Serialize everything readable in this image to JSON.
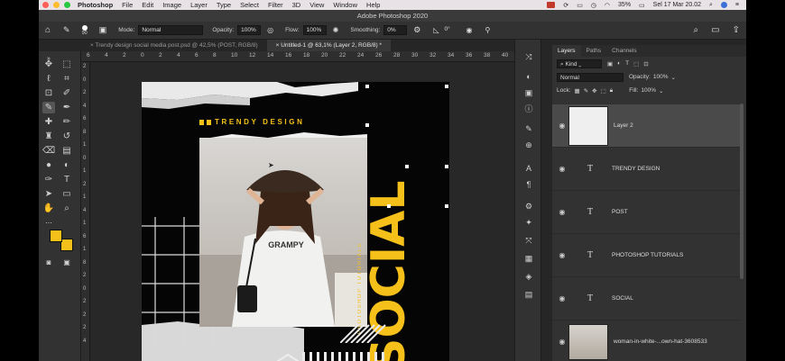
{
  "menubar": {
    "apple": "",
    "items": [
      "Photoshop",
      "File",
      "Edit",
      "Image",
      "Layer",
      "Type",
      "Select",
      "Filter",
      "3D",
      "View",
      "Window",
      "Help"
    ],
    "battery": "35%",
    "clock": "Sel 17 Mar  20.02"
  },
  "window": {
    "title": "Adobe Photoshop 2020"
  },
  "options": {
    "brush_size": "90",
    "mode_label": "Mode:",
    "mode_value": "Normal",
    "opacity_label": "Opacity:",
    "opacity_value": "100%",
    "flow_label": "Flow:",
    "flow_value": "100%",
    "smoothing_label": "Smoothing:",
    "smoothing_value": "0%",
    "angle_value": "0°"
  },
  "tabs": [
    {
      "label": "Trendy design social media post.psd @ 42,5% (POST, RGB/8)"
    },
    {
      "label": "Untitled-1 @ 63,1% (Layer 2, RGB/8) *"
    }
  ],
  "ruler": {
    "top": [
      "6",
      "4",
      "2",
      "0",
      "2",
      "4",
      "6",
      "8",
      "10",
      "12",
      "14",
      "16",
      "18",
      "20",
      "22",
      "24",
      "26",
      "28",
      "30",
      "32",
      "34",
      "36",
      "38",
      "40"
    ],
    "left": [
      "2",
      "0",
      "2",
      "4",
      "6",
      "8",
      "1",
      "0",
      "1",
      "2",
      "1",
      "4",
      "1",
      "6",
      "1",
      "8",
      "2",
      "0",
      "2",
      "2",
      "2",
      "4"
    ]
  },
  "artwork": {
    "header": "TRENDY DESIGN",
    "vertical_big": "SOCIAL",
    "vertical_small": "PHOTOSHOP TUTORIALS",
    "shirt_text": "GRAMPY",
    "colors": {
      "yellow": "#f5c01a",
      "black": "#050505"
    }
  },
  "layers_panel": {
    "tabs": [
      "Layers",
      "Paths",
      "Channels"
    ],
    "kind_label": "Kind",
    "blend_mode": "Normal",
    "opacity_label": "Opacity:",
    "opacity_value": "100%",
    "lock_label": "Lock:",
    "fill_label": "Fill:",
    "fill_value": "100%",
    "layers": [
      {
        "name": "Layer 2"
      },
      {
        "name": "TRENDY DESIGN"
      },
      {
        "name": "POST"
      },
      {
        "name": "PHOTOSHOP TUTORIALS"
      },
      {
        "name": "SOCIAL"
      },
      {
        "name": "woman-in-white-...own-hat-3608533"
      }
    ]
  }
}
